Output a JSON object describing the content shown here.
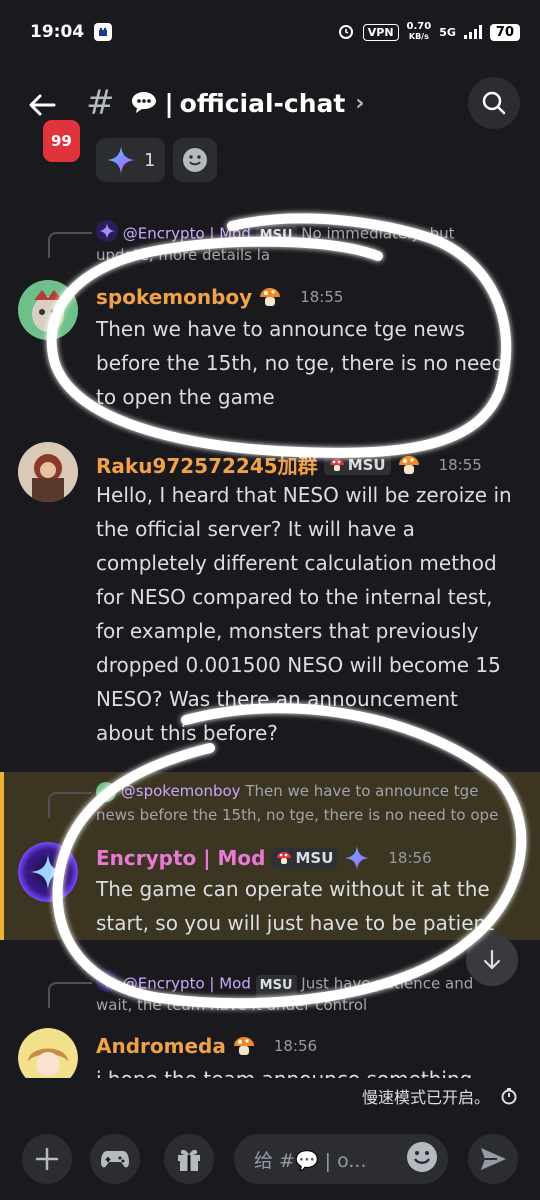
{
  "status_bar": {
    "time": "19:04",
    "vpn": "VPN",
    "net_speed": "0.70",
    "net_unit": "KB/s",
    "network": "5G",
    "battery": "70"
  },
  "header": {
    "unread_count": "99",
    "channel_name": "official-chat"
  },
  "reactions": [
    {
      "emoji_name": "sparkle-icon",
      "count": "1"
    }
  ],
  "messages": [
    {
      "reply_to": "@Encrypto | Mod",
      "reply_tag": "MSU",
      "reply_text": "No immediately, but",
      "reply_text_line2": "update, more details la",
      "author": "spokemonboy",
      "author_color": "#f0a14a",
      "time": "18:55",
      "lines": [
        "Then we have to announce tge news",
        "before the 15th, no tge, there is no need",
        "to open the game"
      ]
    },
    {
      "author": "Raku972572245加群",
      "author_color": "#f0a14a",
      "tag": "MSU",
      "time": "18:55",
      "lines": [
        "Hello, I heard that NESO will be zeroize in",
        "the official server? It will have a",
        "completely different calculation method",
        "for NESO compared to the internal test,",
        "for example, monsters that previously",
        "dropped 0.001500 NESO will become 15",
        "NESO? Was there an announcement",
        "about this before?"
      ]
    },
    {
      "reply_to": "@spokemonboy",
      "reply_text": "Then we have to announce tge",
      "reply_text_line2": "news before the 15th, no tge, there is no need to ope",
      "author": "Encrypto | Mod",
      "author_color": "#e879d4",
      "tag": "MSU",
      "time": "18:56",
      "lines": [
        "The game can operate without it at the",
        "start, so you will just have to be patient"
      ]
    },
    {
      "reply_to": "@Encrypto | Mod",
      "reply_tag": "MSU",
      "reply_text": "Just have patience and",
      "reply_text_line2": "wait, the team have it under control",
      "author": "Andromeda",
      "author_color": "#f0a14a",
      "time": "18:56",
      "lines": [
        "i hope the team announce something"
      ]
    }
  ],
  "slow_mode": "慢速模式已开启。",
  "composer": {
    "placeholder": "给 #💬 | o..."
  },
  "colors": {
    "background": "#1a1a1e",
    "highlight": "#3b3522",
    "accent_bar": "#f0b232",
    "send": "#949ba4"
  }
}
